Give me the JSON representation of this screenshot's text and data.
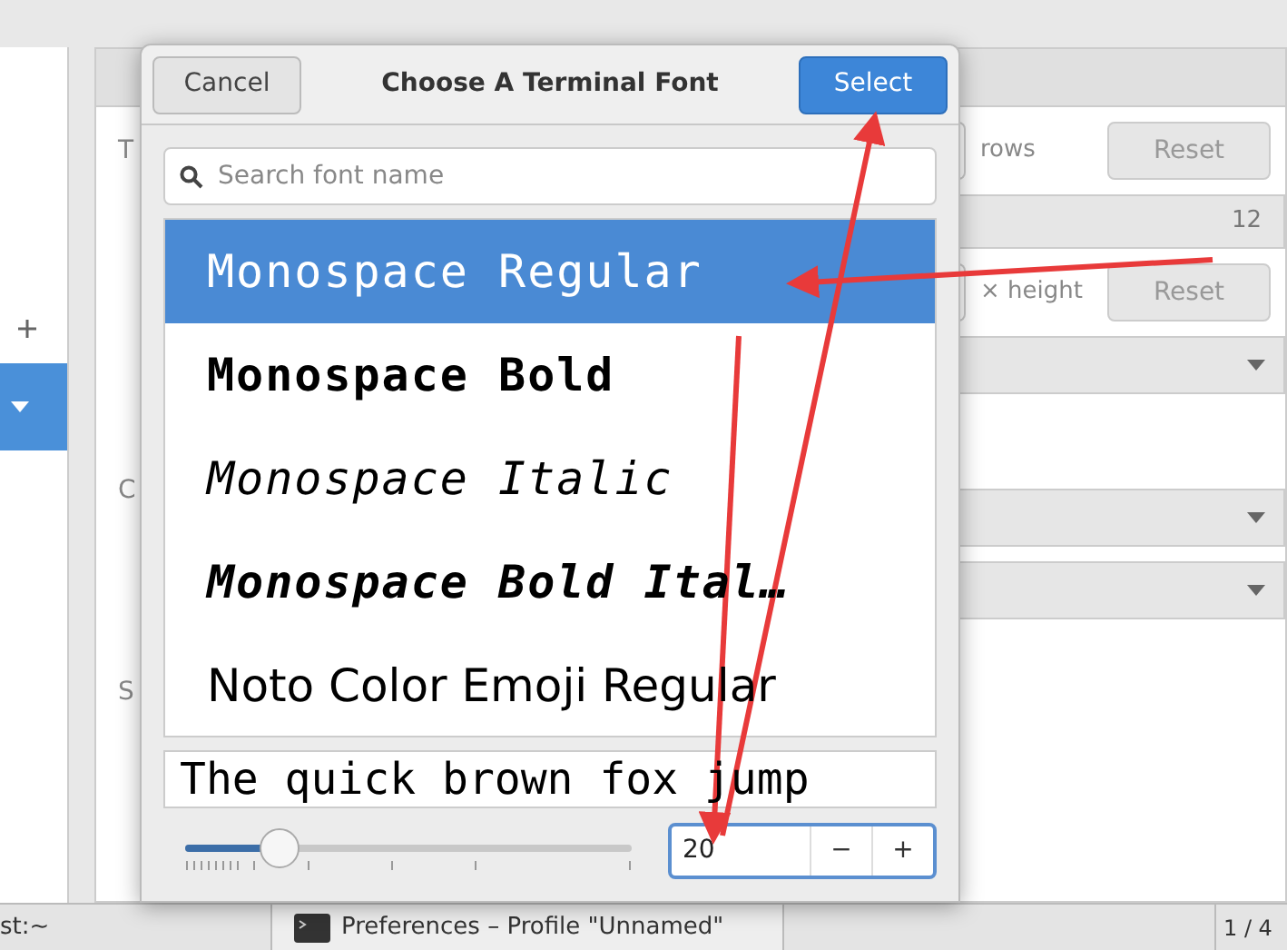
{
  "background_window": {
    "panel_letters": [
      "T",
      "C",
      "S"
    ],
    "rows_label": "rows",
    "height_label": "× height",
    "size_value": "12",
    "reset_buttons": [
      "Reset",
      "Reset"
    ]
  },
  "dialog": {
    "cancel": "Cancel",
    "title": "Choose A Terminal Font",
    "select": "Select",
    "search": {
      "placeholder": "Search font name"
    },
    "fonts": [
      {
        "name": "Monospace Regular",
        "kind": "regular",
        "selected": true
      },
      {
        "name": "Monospace Bold",
        "kind": "bold",
        "selected": false
      },
      {
        "name": "Monospace Italic",
        "kind": "italic",
        "selected": false
      },
      {
        "name": "Monospace Bold Ital…",
        "kind": "bolditalic",
        "selected": false
      },
      {
        "name": "Noto Color Emoji Regular",
        "kind": "sans",
        "selected": false
      }
    ],
    "preview": "The quick brown fox jump",
    "size": {
      "level": 0.21,
      "value": "20",
      "minus": "−",
      "plus": "+"
    }
  },
  "taskbar": {
    "items": [
      "st:~",
      "Preferences – Profile \"Unnamed\""
    ],
    "workspace": "1 / 4"
  }
}
